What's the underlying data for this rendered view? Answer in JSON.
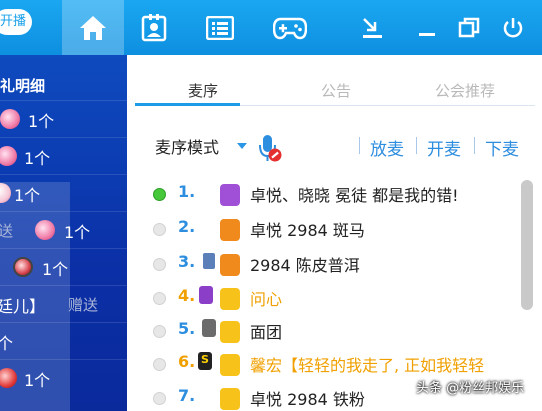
{
  "topbar": {
    "start_button": "开播",
    "icons": [
      "home-icon",
      "profile-card-icon",
      "list-icon",
      "gamepad-icon",
      "download-icon",
      "minimize-icon",
      "restore-icon",
      "power-icon"
    ]
  },
  "left_panel": {
    "title": "礼明细",
    "rows": [
      {
        "count": "1个"
      },
      {
        "count": "1个"
      },
      {
        "count": "1个"
      },
      {
        "prefix": "送",
        "count": "1个"
      },
      {
        "count": "1个"
      },
      {
        "prefix": "廷儿】",
        "action": "赠送"
      },
      {
        "count": "个"
      },
      {
        "count": "1个"
      }
    ]
  },
  "tabs": [
    {
      "label": "麦序",
      "active": true
    },
    {
      "label": "公告",
      "active": false
    },
    {
      "label": "公会推荐",
      "active": false
    }
  ],
  "controls": {
    "mode_label": "麦序模式",
    "actions": [
      "放麦",
      "开麦",
      "下麦"
    ]
  },
  "queue": [
    {
      "num": "1.",
      "name": "卓悦、晓晓 冕徒 都是我的错!",
      "online": true,
      "vip": false
    },
    {
      "num": "2.",
      "name": "卓悦 2984 斑马",
      "online": false,
      "vip": false
    },
    {
      "num": "3.",
      "name": "2984 陈皮普洱",
      "online": false,
      "vip": false
    },
    {
      "num": "4.",
      "name": "问心",
      "online": false,
      "vip": true
    },
    {
      "num": "5.",
      "name": "面团",
      "online": false,
      "vip": false
    },
    {
      "num": "6.",
      "name": "馨宏【轻轻的我走了, 正如我轻轻",
      "online": false,
      "vip": true
    },
    {
      "num": "7.",
      "name": "卓悦 2984 铁粉",
      "online": false,
      "vip": false
    }
  ],
  "watermark": "头条 @粉丝邦娱乐",
  "colors": {
    "accent": "#1e9be6",
    "vip": "#f0a000",
    "left_bg": "#0b2fa6"
  }
}
